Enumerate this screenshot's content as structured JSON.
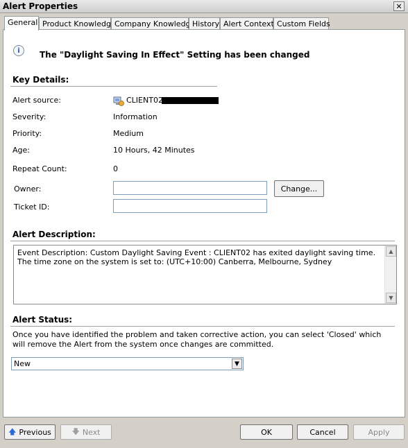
{
  "window": {
    "title": "Alert Properties",
    "close_glyph": "✕"
  },
  "tabs": [
    {
      "label": "General"
    },
    {
      "label": "Product Knowledge"
    },
    {
      "label": "Company Knowledge"
    },
    {
      "label": "History"
    },
    {
      "label": "Alert Context"
    },
    {
      "label": "Custom Fields"
    }
  ],
  "message": {
    "icon": "info-icon",
    "text": "The \"Daylight Saving In Effect\" Setting has been changed"
  },
  "key_details": {
    "title": "Key Details:",
    "alert_source_label": "Alert source:",
    "alert_source_value": "CLIENT02.",
    "severity_label": "Severity:",
    "severity_value": "Information",
    "priority_label": "Priority:",
    "priority_value": "Medium",
    "age_label": "Age:",
    "age_value": "10 Hours, 42 Minutes",
    "repeat_label": "Repeat Count:",
    "repeat_value": "0",
    "owner_label": "Owner:",
    "owner_value": "",
    "change_button": "Change...",
    "ticket_label": "Ticket ID:",
    "ticket_value": ""
  },
  "description": {
    "title": "Alert Description:",
    "text": "Event Description: Custom Daylight Saving Event : CLIENT02 has exited daylight saving time. The time zone on the system is set to: (UTC+10:00) Canberra, Melbourne, Sydney"
  },
  "status": {
    "title": "Alert Status:",
    "text": "Once you have identified the problem and taken corrective action, you can select 'Closed' which will remove the Alert from the system once changes are committed.",
    "selected": "New"
  },
  "footer": {
    "previous": "Previous",
    "next": "Next",
    "ok": "OK",
    "cancel": "Cancel",
    "apply": "Apply"
  }
}
